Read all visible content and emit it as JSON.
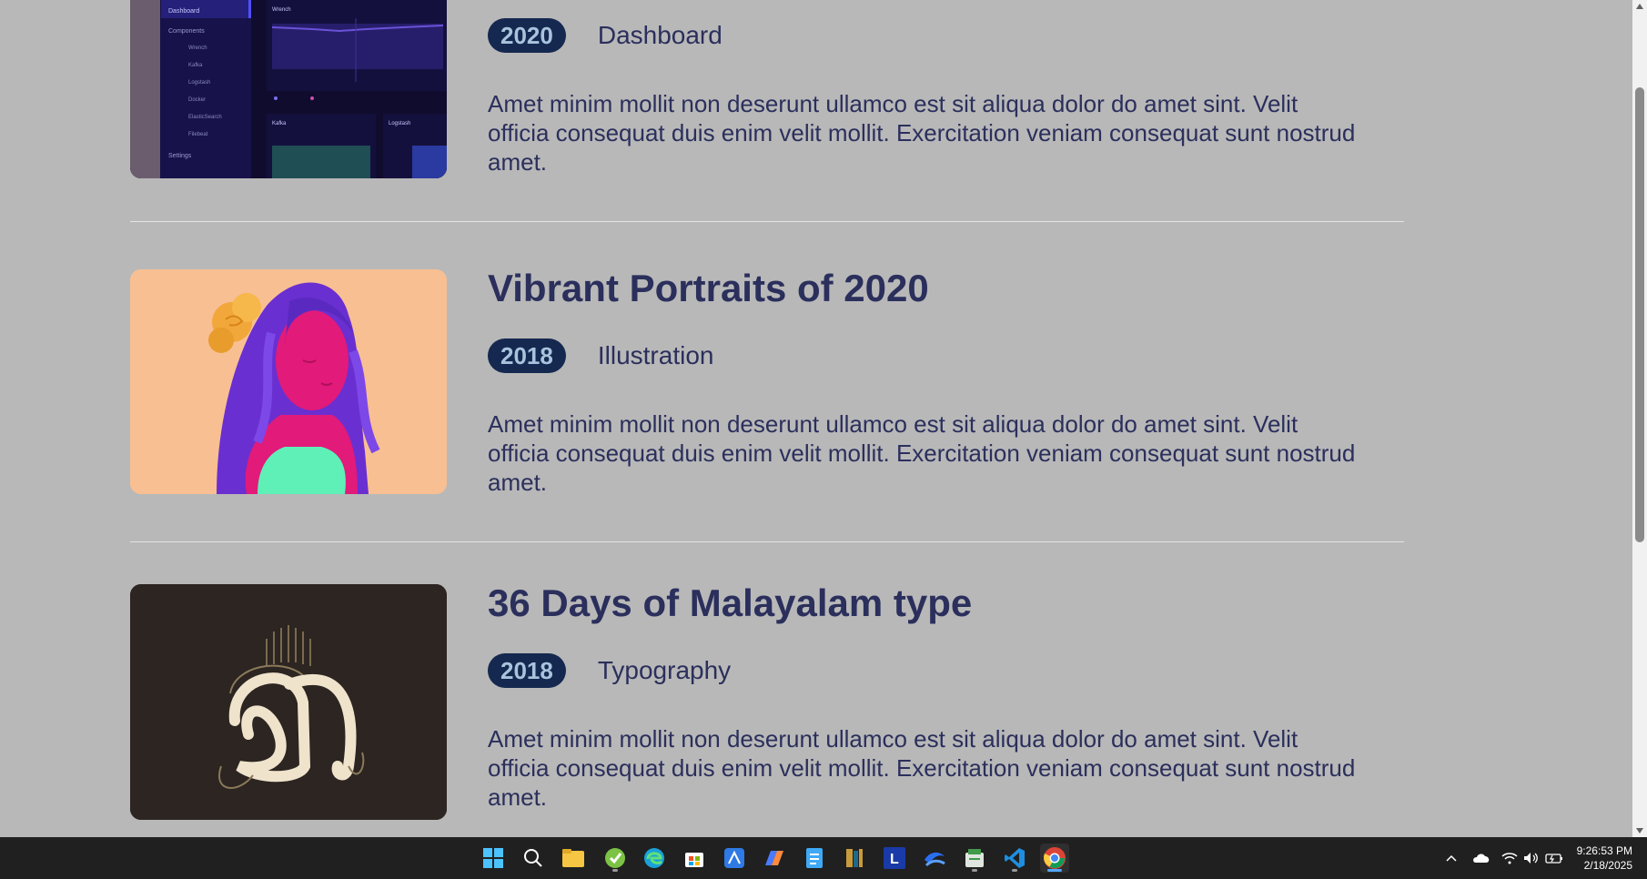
{
  "works": [
    {
      "title": "",
      "year": "2020",
      "category": "Dashboard",
      "description": "Amet minim mollit non deserunt ullamco est sit aliqua dolor do amet sint. Velit officia consequat duis enim velit mollit. Exercitation veniam consequat sunt nostrud amet.",
      "image": "dashboard-screenshot",
      "dashboard_preview": {
        "nav": [
          "Dashboard",
          "Components",
          "Wrench",
          "Kafka",
          "Logstash",
          "Docker",
          "ElasticSearch",
          "Filebeat",
          "Settings"
        ],
        "panels": [
          "Wrench",
          "Kafka",
          "Logstash"
        ]
      }
    },
    {
      "title": "Vibrant Portraits of 2020",
      "year": "2018",
      "category": "Illustration",
      "description": "Amet minim mollit non deserunt ullamco est sit aliqua dolor do amet sint. Velit officia consequat duis enim velit mollit. Exercitation veniam consequat sunt nostrud amet.",
      "image": "portrait-illustration"
    },
    {
      "title": "36 Days of Malayalam type",
      "year": "2018",
      "category": "Typography",
      "description": "Amet minim mollit non deserunt ullamco est sit aliqua dolor do amet sint. Velit officia consequat duis enim velit mollit. Exercitation veniam consequat sunt nostrud amet.",
      "image": "malayalam-letter"
    }
  ],
  "taskbar": {
    "apps": [
      "windows-start-icon",
      "search-icon",
      "file-explorer-icon",
      "cleaner-icon",
      "edge-icon",
      "store-icon",
      "app-icon",
      "copilot-icon",
      "notepad-icon",
      "books-icon",
      "l-app-icon",
      "app-icon",
      "terminal-icon",
      "vscode-icon",
      "chrome-icon"
    ],
    "time": "9:26:53 PM",
    "date": "2/18/2025"
  }
}
